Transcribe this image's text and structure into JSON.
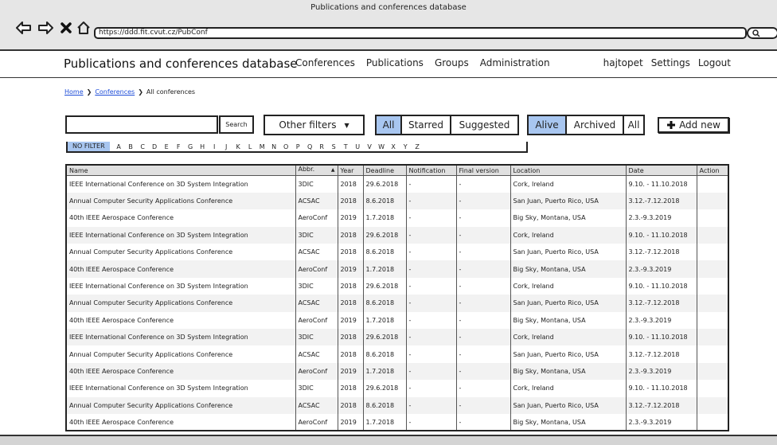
{
  "browser": {
    "window_title": "Publications and conferences database",
    "url": "https://ddd.fit.cvut.cz/PubConf"
  },
  "header": {
    "app_title": "Publications and conferences database",
    "nav": [
      "Conferences",
      "Publications",
      "Groups",
      "Administration"
    ],
    "user": "hajtopet",
    "settings": "Settings",
    "logout": "Logout"
  },
  "breadcrumb": {
    "home": "Home",
    "conferences": "Conferences",
    "current": "All conferences"
  },
  "filters": {
    "search_label": "Search",
    "other_filters": "Other filters",
    "scope": [
      "All",
      "Starred",
      "Suggested"
    ],
    "scope_active": 0,
    "status": [
      "Alive",
      "Archived",
      "All"
    ],
    "status_active": 0,
    "add_new": "Add new",
    "no_filter": "NO FILTER",
    "letters": [
      "A",
      "B",
      "C",
      "D",
      "E",
      "F",
      "G",
      "H",
      "I",
      "J",
      "K",
      "L",
      "M",
      "N",
      "O",
      "P",
      "Q",
      "R",
      "S",
      "T",
      "U",
      "V",
      "W",
      "X",
      "Y",
      "Z"
    ]
  },
  "table": {
    "columns": [
      "Name",
      "Abbr.",
      "Year",
      "Deadline",
      "Notification",
      "Final version",
      "Location",
      "Date",
      "Action"
    ],
    "sort_icon": "sort-ascending-icon",
    "rows": [
      [
        "IEEE International Conference on 3D System Integration",
        "3DIC",
        "2018",
        "29.6.2018",
        "-",
        "-",
        "Cork, Ireland",
        "9.10. - 11.10.2018",
        ""
      ],
      [
        "Annual Computer Security Applications Conference",
        "ACSAC",
        "2018",
        "8.6.2018",
        "-",
        "-",
        "San Juan, Puerto Rico, USA",
        "3.12.-7.12.2018",
        ""
      ],
      [
        "40th IEEE Aerospace Conference",
        "AeroConf",
        "2019",
        "1.7.2018",
        "-",
        "-",
        "Big Sky, Montana, USA",
        "2.3.-9.3.2019",
        ""
      ],
      [
        "IEEE International Conference on 3D System Integration",
        "3DIC",
        "2018",
        "29.6.2018",
        "-",
        "-",
        "Cork, Ireland",
        "9.10. - 11.10.2018",
        ""
      ],
      [
        "Annual Computer Security Applications Conference",
        "ACSAC",
        "2018",
        "8.6.2018",
        "-",
        "-",
        "San Juan, Puerto Rico, USA",
        "3.12.-7.12.2018",
        ""
      ],
      [
        "40th IEEE Aerospace Conference",
        "AeroConf",
        "2019",
        "1.7.2018",
        "-",
        "-",
        "Big Sky, Montana, USA",
        "2.3.-9.3.2019",
        ""
      ],
      [
        "IEEE International Conference on 3D System Integration",
        "3DIC",
        "2018",
        "29.6.2018",
        "-",
        "-",
        "Cork, Ireland",
        "9.10. - 11.10.2018",
        ""
      ],
      [
        "Annual Computer Security Applications Conference",
        "ACSAC",
        "2018",
        "8.6.2018",
        "-",
        "-",
        "San Juan, Puerto Rico, USA",
        "3.12.-7.12.2018",
        ""
      ],
      [
        "40th IEEE Aerospace Conference",
        "AeroConf",
        "2019",
        "1.7.2018",
        "-",
        "-",
        "Big Sky, Montana, USA",
        "2.3.-9.3.2019",
        ""
      ],
      [
        "IEEE International Conference on 3D System Integration",
        "3DIC",
        "2018",
        "29.6.2018",
        "-",
        "-",
        "Cork, Ireland",
        "9.10. - 11.10.2018",
        ""
      ],
      [
        "Annual Computer Security Applications Conference",
        "ACSAC",
        "2018",
        "8.6.2018",
        "-",
        "-",
        "San Juan, Puerto Rico, USA",
        "3.12.-7.12.2018",
        ""
      ],
      [
        "40th IEEE Aerospace Conference",
        "AeroConf",
        "2019",
        "1.7.2018",
        "-",
        "-",
        "Big Sky, Montana, USA",
        "2.3.-9.3.2019",
        ""
      ],
      [
        "IEEE International Conference on 3D System Integration",
        "3DIC",
        "2018",
        "29.6.2018",
        "-",
        "-",
        "Cork, Ireland",
        "9.10. - 11.10.2018",
        ""
      ],
      [
        "Annual Computer Security Applications Conference",
        "ACSAC",
        "2018",
        "8.6.2018",
        "-",
        "-",
        "San Juan, Puerto Rico, USA",
        "3.12.-7.12.2018",
        ""
      ],
      [
        "40th IEEE Aerospace Conference",
        "AeroConf",
        "2019",
        "1.7.2018",
        "-",
        "-",
        "Big Sky, Montana, USA",
        "2.3.-9.3.2019",
        ""
      ]
    ]
  },
  "colors": {
    "accent": "#a8c6f0",
    "link": "#1e4dd8",
    "header_bg": "#e0e0e0",
    "row_alt": "#f2f2f2"
  }
}
